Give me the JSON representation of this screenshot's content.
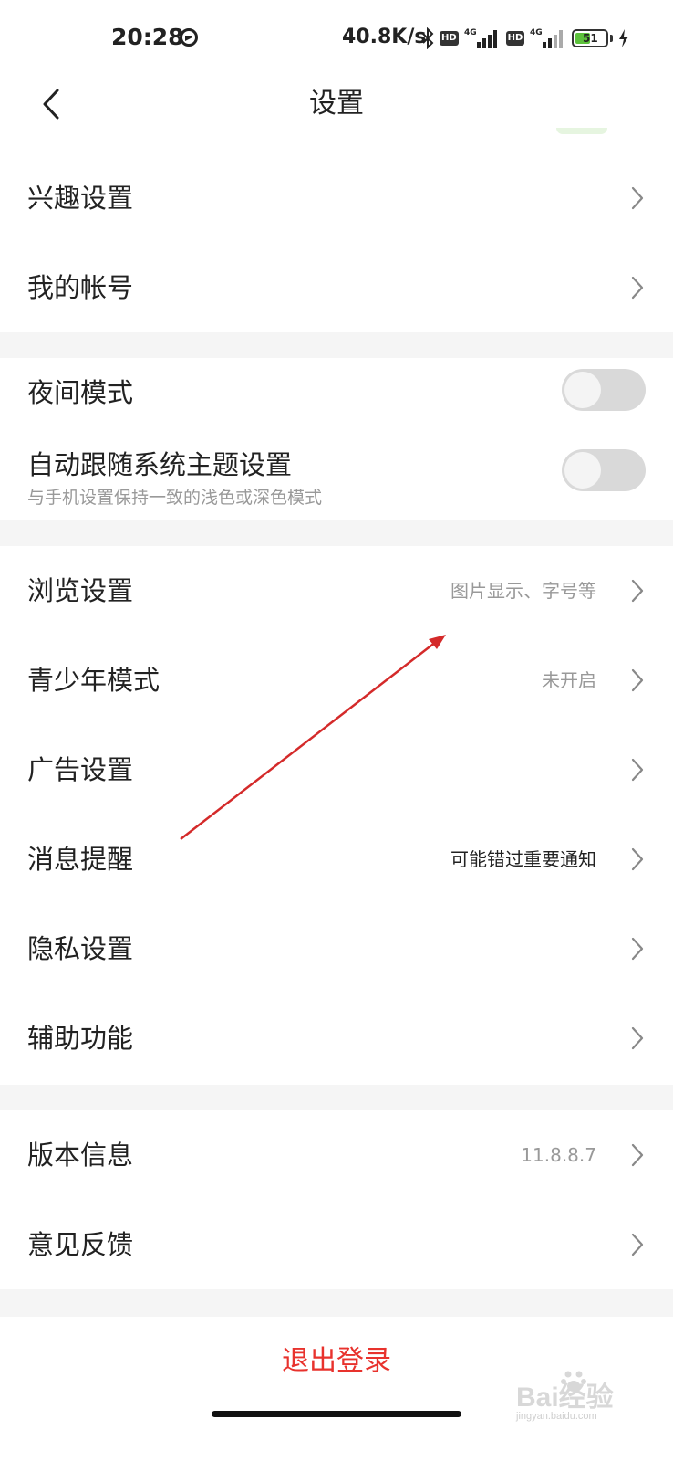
{
  "status_bar": {
    "time": "20:28",
    "speed": "40.8K/s",
    "hd1": "HD",
    "net1": "4G",
    "hd2": "HD",
    "net2": "4G",
    "battery": "51",
    "battery_level": 0.51
  },
  "nav": {
    "title": "设置"
  },
  "group1": [
    {
      "label": "兴趣设置"
    },
    {
      "label": "我的帐号"
    }
  ],
  "group2": {
    "night_mode": {
      "label": "夜间模式",
      "on": false
    },
    "auto_theme": {
      "label": "自动跟随系统主题设置",
      "sub": "与手机设置保持一致的浅色或深色模式",
      "on": false
    }
  },
  "group3": [
    {
      "label": "浏览设置",
      "value": "图片显示、字号等"
    },
    {
      "label": "青少年模式",
      "value": "未开启"
    },
    {
      "label": "广告设置",
      "value": ""
    },
    {
      "label": "消息提醒",
      "value": "可能错过重要通知"
    },
    {
      "label": "隐私设置",
      "value": ""
    },
    {
      "label": "辅助功能",
      "value": ""
    }
  ],
  "group4": [
    {
      "label": "版本信息",
      "value": "11.8.8.7"
    },
    {
      "label": "意见反馈",
      "value": ""
    }
  ],
  "logout_label": "退出登录",
  "watermark": {
    "main": "Bai经验",
    "sub": "jingyan.baidu.com"
  },
  "colors": {
    "accent_red": "#e8322d",
    "annotation_arrow": "#d42a2a",
    "toggle_off": "#d9d9d9",
    "section_gap": "#f5f5f5",
    "battery_green": "#5cc13b"
  }
}
